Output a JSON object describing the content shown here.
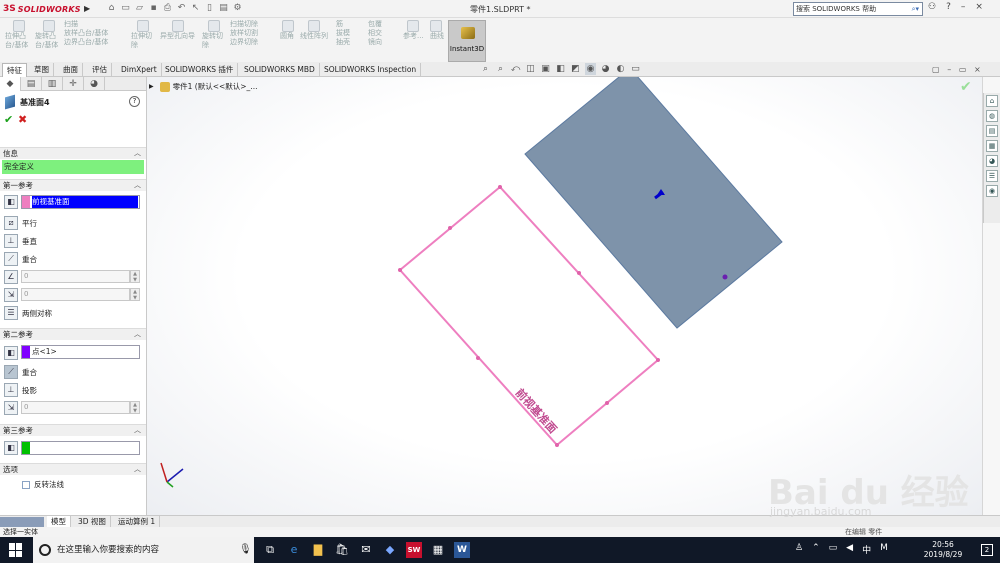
{
  "app": {
    "brand": "SOLIDWORKS",
    "window_title": "零件1.SLDPRT *"
  },
  "help_search": {
    "placeholder": "搜索 SOLIDWORKS 帮助"
  },
  "ribbon": {
    "groups": [
      {
        "label_1": "拉伸凸",
        "label_2": "台/基体"
      },
      {
        "label_1": "旋转凸",
        "label_2": "台/基体"
      },
      {
        "label_1": "扫描",
        "label_2": "放样凸台/基体",
        "label_3": "边界凸台/基体"
      },
      {
        "label_1": "拉伸切",
        "label_2": "除"
      },
      {
        "label_1": "异型孔向导"
      },
      {
        "label_1": "旋转切",
        "label_2": "除"
      },
      {
        "label_1": "扫描切除",
        "label_2": "放样切割",
        "label_3": "边界切除"
      },
      {
        "label_1": "圆角"
      },
      {
        "label_1": "线性阵列"
      },
      {
        "label_1": "筋",
        "label_2": "拔模",
        "label_3": "抽壳"
      },
      {
        "label_1": "包覆",
        "label_2": "相交",
        "label_3": "镜向"
      },
      {
        "label_1": "参考..."
      },
      {
        "label_1": "曲线"
      }
    ],
    "instant3d": "Instant3D"
  },
  "tabs": [
    "特征",
    "草图",
    "曲面",
    "评估",
    "DimXpert",
    "SOLIDWORKS 插件",
    "SOLIDWORKS MBD",
    "SOLIDWORKS Inspection"
  ],
  "feature_tree": {
    "root": "零件1  (默认<<默认>_..."
  },
  "property_manager": {
    "title": "基准面4",
    "help": "?",
    "sections": {
      "info": "信息",
      "status": "完全定义",
      "first_ref": "第一参考",
      "second_ref": "第二参考",
      "third_ref": "第三参考",
      "options": "选项"
    },
    "first_ref_value": "前视基准面",
    "first_options": [
      "平行",
      "垂直",
      "重合"
    ],
    "first_spin_1": "0",
    "first_spin_2": "0",
    "first_mirror": "两侧对称",
    "second_ref_value": "点<1>",
    "second_options": [
      "重合",
      "投影"
    ],
    "second_spin": "0",
    "third_ref_value": "",
    "flip_normal": "反转法线"
  },
  "bottom_tabs": [
    "模型",
    "3D 视图",
    "运动算例 1"
  ],
  "status_text": "选择一实体",
  "status_right": "在编辑 零件",
  "canvas_label": "前视基准面",
  "taskbar": {
    "search_placeholder": "在这里输入你要搜索的内容",
    "time": "20:56",
    "date": "2019/8/29",
    "ime": "中",
    "ime2": "M",
    "notif_count": "2"
  },
  "watermark": {
    "brand": "Bai du 经验",
    "url": "jingyan.baidu.com"
  },
  "colors": {
    "brand_red": "#c8102e",
    "plane_fill": "#7e93aa",
    "sketch_pink": "#ee7fc0",
    "status_green": "#7ef07e",
    "selection_blue": "#0000ff",
    "second_ref_purple": "#8000ff",
    "third_ref_green": "#00c000"
  }
}
